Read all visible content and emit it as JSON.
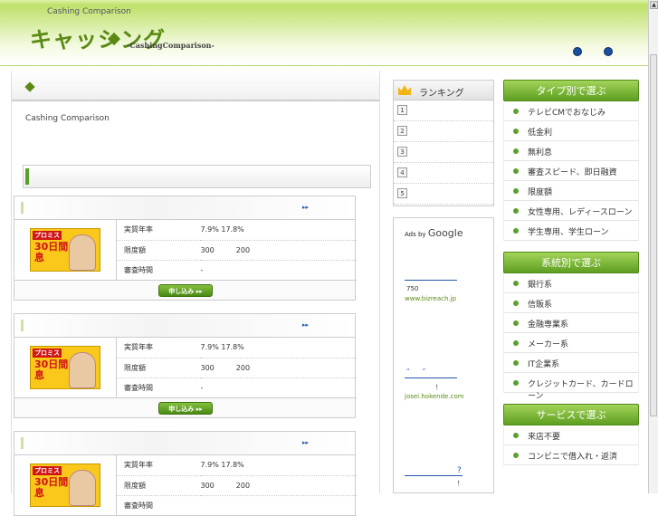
{
  "header": {
    "tagline": "Cashing Comparison",
    "logo": "キャッシング",
    "logo_en": "-CashingComparison-"
  },
  "main": {
    "intro": "Cashing Comparison"
  },
  "cards": [
    {
      "rows": [
        {
          "k": "実質年率",
          "v": "7.9% 17.8%"
        },
        {
          "k": "限度額",
          "v": "300　　　200"
        },
        {
          "k": "審査時間",
          "v": "-"
        }
      ],
      "banner_top": "プロミス",
      "banner_main": "30日間 無利息",
      "apply": "申し込み ▸▸",
      "ff": "▸▸"
    },
    {
      "rows": [
        {
          "k": "実質年率",
          "v": "7.9% 17.8%"
        },
        {
          "k": "限度額",
          "v": "300　　　200"
        },
        {
          "k": "審査時間",
          "v": "-"
        }
      ],
      "banner_top": "プロミス",
      "banner_main": "30日間 無利息",
      "apply": "申し込み ▸▸",
      "ff": "▸▸"
    },
    {
      "rows": [
        {
          "k": "実質年率",
          "v": "7.9% 17.8%"
        },
        {
          "k": "限度額",
          "v": "300　　　200"
        },
        {
          "k": "審査時間",
          "v": ""
        }
      ],
      "banner_top": "プロミス",
      "banner_main": "30日間 無利息",
      "apply": "",
      "ff": "▸▸"
    }
  ],
  "ranking": {
    "title": "ランキング",
    "items": [
      "1",
      "2",
      "3",
      "4",
      "5"
    ]
  },
  "ads": {
    "label": "Ads by",
    "brand": "Google",
    "a1_text": "750",
    "a1_url": "www.bizreach.jp",
    "a2_quote": "“　　”",
    "a2_text": "！",
    "a2_url": "josei.hokende.com",
    "a3_q": "?",
    "a3_text": "！"
  },
  "sidebar": [
    {
      "title": "タイプ別で選ぶ",
      "items": [
        "テレビCMでおなじみ",
        "低金利",
        "無利息",
        "審査スピード、即日融資",
        "限度額",
        "女性専用、レディースローン",
        "学生専用、学生ローン"
      ]
    },
    {
      "title": "系統別で選ぶ",
      "items": [
        "銀行系",
        "信販系",
        "金融専業系",
        "メーカー系",
        "IT企業系",
        "クレジットカード、カードローン"
      ]
    },
    {
      "title": "サービスで選ぶ",
      "items": [
        "来店不要",
        "コンビニで借入れ・返済"
      ]
    }
  ],
  "colors": {
    "accent": "#5a8a14",
    "link": "#2255aa"
  }
}
